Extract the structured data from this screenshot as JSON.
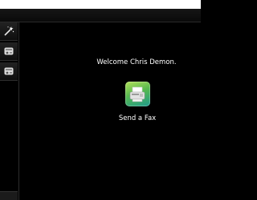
{
  "sidebar": {
    "buttons": [
      {
        "icon": "magic-wand-icon"
      },
      {
        "icon": "scan-device-icon"
      },
      {
        "icon": "scan-device-icon"
      }
    ]
  },
  "main": {
    "welcome_text": "Welcome Chris Demon.",
    "apps": [
      {
        "label": "Send a Fax",
        "icon": "fax-machine-icon"
      }
    ]
  },
  "colors": {
    "background": "#000000",
    "text": "#ffffff",
    "fax_icon_gradient": [
      "#b4e25a",
      "#57b84f",
      "#1f9b8e"
    ]
  }
}
